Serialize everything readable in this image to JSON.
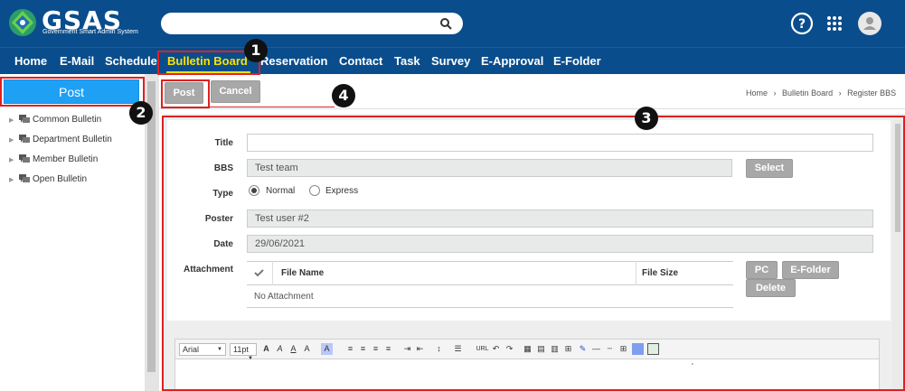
{
  "header": {
    "logo_text": "GSAS",
    "logo_sub": "Government Smart Admin System",
    "search_placeholder": "",
    "icons": [
      "help-icon",
      "apps-grid-icon",
      "user-avatar-icon"
    ]
  },
  "menu": {
    "items": [
      {
        "label": "Home"
      },
      {
        "label": "E-Mail"
      },
      {
        "label": "Schedule"
      },
      {
        "label": "Bulletin Board",
        "active": true
      },
      {
        "label": "Reservation"
      },
      {
        "label": "Contact"
      },
      {
        "label": "Task"
      },
      {
        "label": "Survey"
      },
      {
        "label": "E-Approval"
      },
      {
        "label": "E-Folder"
      }
    ]
  },
  "annotations": [
    "1",
    "2",
    "3",
    "4"
  ],
  "sidebar": {
    "post_label": "Post",
    "items": [
      {
        "label": "Common Bulletin"
      },
      {
        "label": "Department Bulletin"
      },
      {
        "label": "Member Bulletin"
      },
      {
        "label": "Open Bulletin"
      }
    ]
  },
  "actions": {
    "post": "Post",
    "cancel": "Cancel"
  },
  "breadcrumb": {
    "home": "Home",
    "section": "Bulletin Board",
    "page": "Register BBS",
    "separator": "›"
  },
  "form": {
    "title_label": "Title",
    "title_value": "",
    "bbs_label": "BBS",
    "bbs_value": "Test team",
    "select_label": "Select",
    "type_label": "Type",
    "type_options": [
      {
        "label": "Normal",
        "checked": true
      },
      {
        "label": "Express",
        "checked": false
      }
    ],
    "poster_label": "Poster",
    "poster_value": "Test user #2",
    "date_label": "Date",
    "date_value": "29/06/2021",
    "attachment_label": "Attachment",
    "attachment_columns": [
      "File Name",
      "File Size"
    ],
    "attachment_empty": "No Attachment",
    "attachment_buttons": {
      "pc": "PC",
      "efolder": "E-Folder",
      "delete": "Delete"
    }
  },
  "editor": {
    "font": "Arial",
    "size": "11pt",
    "url_label": "URL"
  },
  "colors": {
    "header_bg": "#0a4d8c",
    "active_menu": "#ffe000",
    "post_button": "#1ea0f5",
    "annotation_box": "#e02020"
  }
}
